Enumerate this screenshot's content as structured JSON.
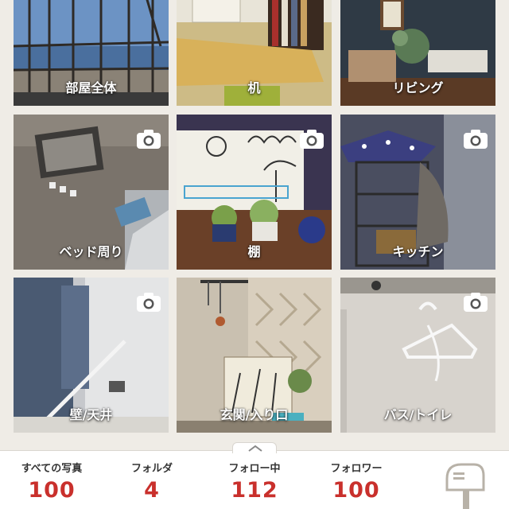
{
  "folders": [
    {
      "label": "部屋全体",
      "camera": false
    },
    {
      "label": "机",
      "camera": false
    },
    {
      "label": "リビング",
      "camera": false
    },
    {
      "label": "ベッド周り",
      "camera": true
    },
    {
      "label": "棚",
      "camera": true
    },
    {
      "label": "キッチン",
      "camera": true
    },
    {
      "label": "壁/天井",
      "camera": true
    },
    {
      "label": "玄関/入り口",
      "camera": false
    },
    {
      "label": "バス/トイレ",
      "camera": true
    }
  ],
  "stats": [
    {
      "label": "すべての写真",
      "value": "100"
    },
    {
      "label": "フォルダ",
      "value": "4"
    },
    {
      "label": "フォロー中",
      "value": "112"
    },
    {
      "label": "フォロワー",
      "value": "100"
    }
  ],
  "icons": {
    "camera": "camera-icon",
    "mailbox": "mailbox-icon",
    "chevron": "chevron-up-icon"
  },
  "colors": {
    "accent": "#c9302c",
    "background": "#efece6"
  }
}
